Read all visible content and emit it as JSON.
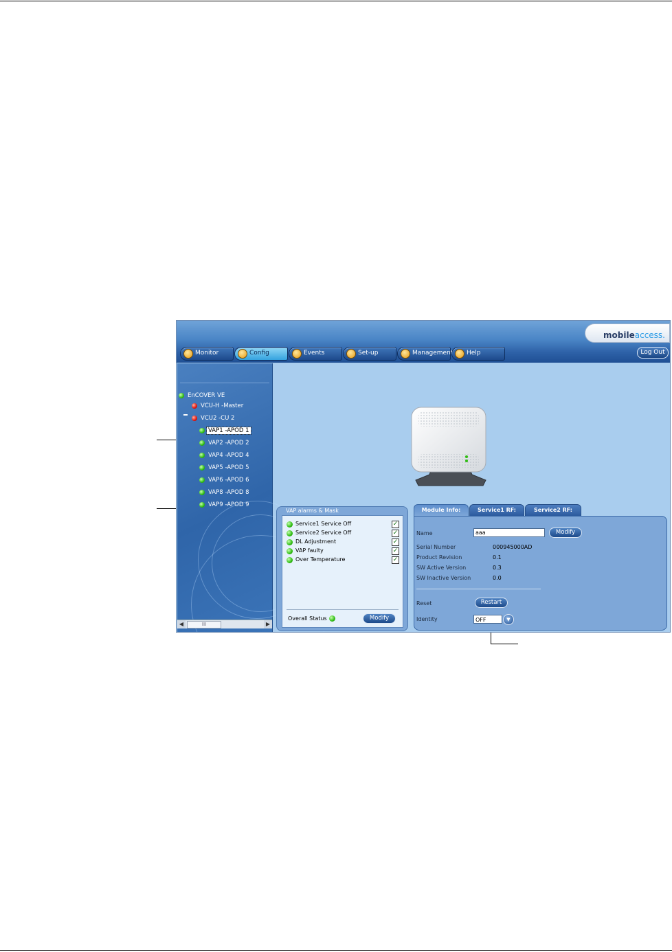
{
  "header": {
    "logo": {
      "part1": "mobile",
      "part2": "access."
    },
    "nav": [
      {
        "label": "Monitor",
        "icon": "monitor-icon"
      },
      {
        "label": "Config",
        "icon": "wrench-icon"
      },
      {
        "label": "Events",
        "icon": "events-icon"
      },
      {
        "label": "Set-up",
        "icon": "setup-icon"
      },
      {
        "label": "Management",
        "icon": "management-icon"
      },
      {
        "label": "Help",
        "icon": "help-icon"
      }
    ],
    "active_tab": "Config",
    "logout_label": "Log Out"
  },
  "tree": {
    "nodes": [
      {
        "label": "EnCOVER VE",
        "status": "green"
      },
      {
        "label": "VCU-H -Master",
        "status": "red"
      },
      {
        "label": "VCU2 -CU 2",
        "status": "red"
      },
      {
        "label": "VAP1 -APOD 1",
        "status": "green",
        "selected": true
      },
      {
        "label": "VAP2 -APOD 2",
        "status": "green"
      },
      {
        "label": "VAP4 -APOD 4",
        "status": "green"
      },
      {
        "label": "VAP5 -APOD 5",
        "status": "green"
      },
      {
        "label": "VAP6 -APOD 6",
        "status": "green"
      },
      {
        "label": "VAP8 -APOD 8",
        "status": "green"
      },
      {
        "label": "VAP9 -APOD 9",
        "status": "green"
      }
    ],
    "scroll_thumb_text": "III"
  },
  "alarms": {
    "title": "VAP alarms & Mask",
    "items": [
      {
        "label": "Service1 Service Off",
        "status": "green",
        "masked": true
      },
      {
        "label": "Service2 Service Off",
        "status": "green",
        "masked": true
      },
      {
        "label": "DL Adjustment",
        "status": "green",
        "masked": true
      },
      {
        "label": "VAP faulty",
        "status": "green",
        "masked": true
      },
      {
        "label": "Over Temperature",
        "status": "green",
        "masked": true
      }
    ],
    "overall_status_label": "Overall Status",
    "overall_status": "green",
    "modify_label": "Modify"
  },
  "module": {
    "tabs": [
      "Module Info:",
      "Service1 RF:",
      "Service2 RF:"
    ],
    "active_tab": "Module Info:",
    "name_label": "Name",
    "name_value": "aaa",
    "modify_label": "Modify",
    "serial_label": "Serial Number",
    "serial_value": "000945000AD",
    "revision_label": "Product Revision",
    "revision_value": "0.1",
    "sw_active_label": "SW Active Version",
    "sw_active_value": "0.3",
    "sw_inactive_label": "SW Inactive Version",
    "sw_inactive_value": "0.0",
    "reset_label": "Reset",
    "restart_label": "Restart",
    "identity_label": "Identity",
    "identity_value": "OFF"
  },
  "colors": {
    "status_green": "#2fbd13",
    "status_red": "#e2140d",
    "accent_blue": "#2e62a8"
  }
}
